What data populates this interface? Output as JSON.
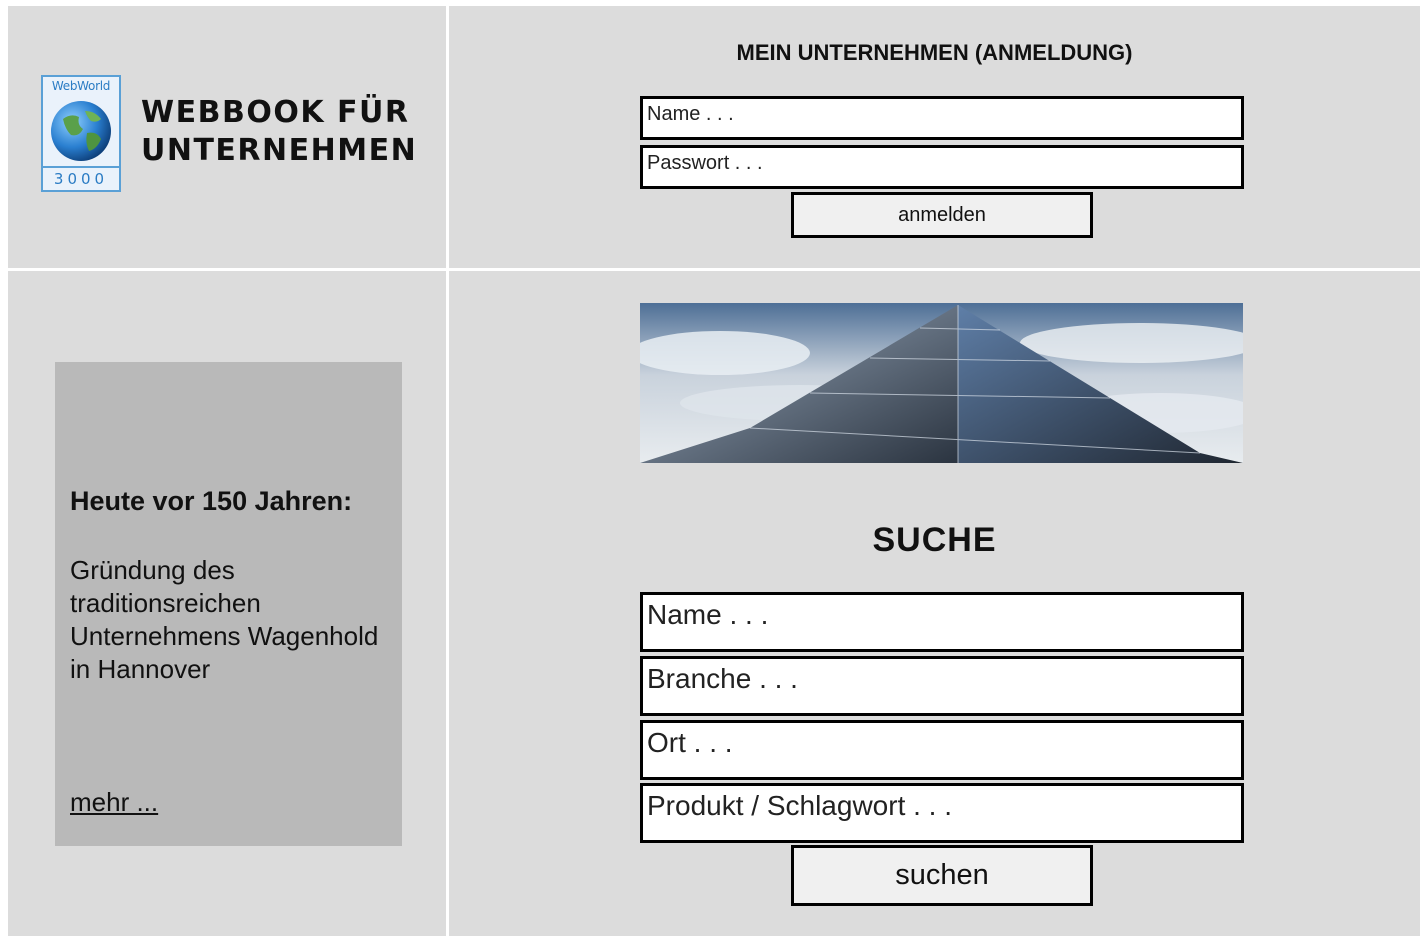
{
  "logo": {
    "badge_top": "WebWorld",
    "badge_bottom": "3000",
    "title_line1": "WEBBOOK FÜR",
    "title_line2": "UNTERNEHMEN"
  },
  "login": {
    "heading": "MEIN UNTERNEHMEN (ANMELDUNG)",
    "name_placeholder": "Name . . .",
    "password_placeholder": "Passwort . . .",
    "button_label": "anmelden"
  },
  "news": {
    "heading": "Heute vor 150 Jahren:",
    "text": "Gründung des traditionsreichen Unternehmens Wagenhold in Hannover",
    "more_link": "mehr ..."
  },
  "search": {
    "heading": "SUCHE",
    "name_placeholder": "Name . . .",
    "branche_placeholder": "Branche . . .",
    "ort_placeholder": "Ort . . .",
    "produkt_placeholder": "Produkt / Schlagwort . . .",
    "button_label": "suchen"
  },
  "colors": {
    "cell_background": "#dcdcdc",
    "news_box_background": "#b9b9b9",
    "logo_blue": "#2b7cc4"
  },
  "icons": {
    "logo": "globe-icon"
  }
}
